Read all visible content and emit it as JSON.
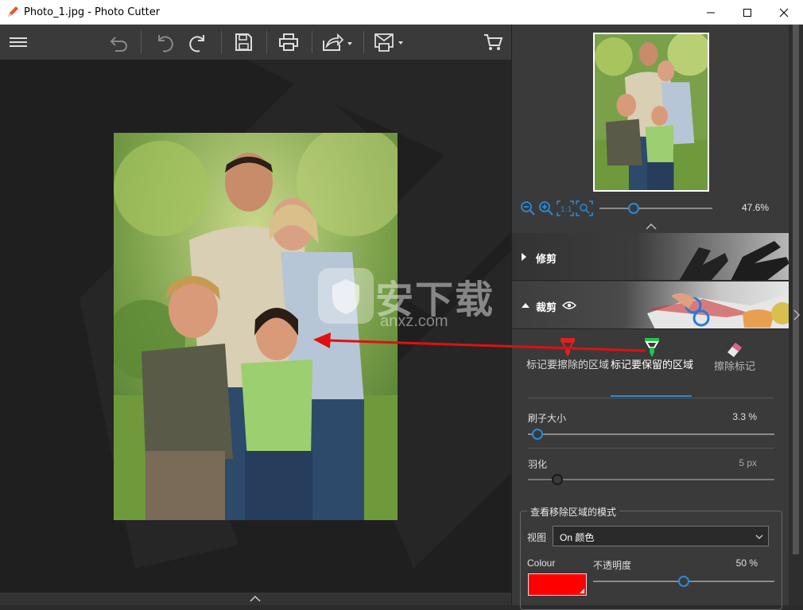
{
  "window": {
    "title": "Photo_1.jpg - Photo Cutter",
    "controls": [
      "minimize",
      "maximize",
      "close"
    ]
  },
  "toolbar": {
    "items": [
      "menu-icon",
      "undo-history-icon",
      "undo-icon",
      "redo-icon",
      "save-icon",
      "print-icon",
      "share-icon",
      "export-icon",
      "cart-icon"
    ]
  },
  "navigator": {
    "zoom_percent": "47.6%",
    "zoom_slider_value": 0.3,
    "tools": [
      "zoom-out-icon",
      "zoom-in-icon",
      "actual-size-icon",
      "fit-icon"
    ]
  },
  "sections": {
    "trim": {
      "label": "修剪",
      "expanded": false
    },
    "crop": {
      "label": "裁剪",
      "expanded": true
    }
  },
  "mark_modes": {
    "erase": {
      "label": "标记要擦除的区域"
    },
    "keep": {
      "label": "标记要保留的区域",
      "active": true
    },
    "clear": {
      "label": "擦除标记"
    }
  },
  "brush_size": {
    "label": "刷子大小",
    "value": "3.3 %",
    "level": 0.04
  },
  "feather": {
    "label": "羽化",
    "value": "5 px",
    "level": 0.12
  },
  "view_mode": {
    "legend": "查看移除区域的模式",
    "view_label": "视图",
    "view_value": "On 颜色",
    "colour_label": "Colour",
    "colour_value": "#ff0000",
    "opacity_label": "不透明度",
    "opacity_value": "50 %",
    "opacity_level": 0.5
  },
  "watermark": {
    "text": "安下载",
    "sub": "anxz.com"
  },
  "colors": {
    "accent": "#2a8ad8",
    "panel": "#3a3a3a",
    "canvas": "#1f1f1f"
  }
}
